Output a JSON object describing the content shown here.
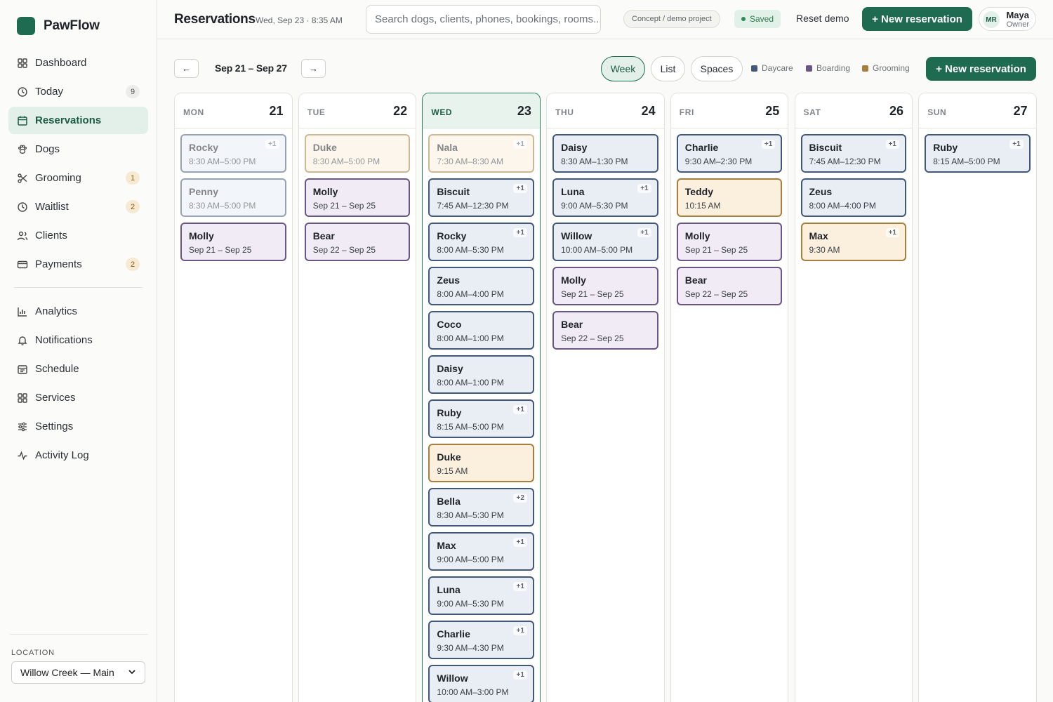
{
  "app": {
    "name": "PawFlow"
  },
  "sidebar": {
    "items": [
      {
        "label": "Dashboard",
        "icon": "dashboard-icon",
        "badge": ""
      },
      {
        "label": "Today",
        "icon": "clock-icon",
        "badge": "9"
      },
      {
        "label": "Reservations",
        "icon": "calendar-icon",
        "badge": ""
      },
      {
        "label": "Dogs",
        "icon": "paw-icon",
        "badge": ""
      },
      {
        "label": "Grooming",
        "icon": "scissors-icon",
        "badge": "1"
      },
      {
        "label": "Waitlist",
        "icon": "clock-icon",
        "badge": "2"
      },
      {
        "label": "Clients",
        "icon": "users-icon",
        "badge": ""
      },
      {
        "label": "Payments",
        "icon": "card-icon",
        "badge": "2"
      }
    ],
    "secondary": [
      {
        "label": "Analytics",
        "icon": "chart-icon"
      },
      {
        "label": "Notifications",
        "icon": "bell-icon"
      },
      {
        "label": "Schedule",
        "icon": "schedule-icon"
      },
      {
        "label": "Services",
        "icon": "grid-icon"
      },
      {
        "label": "Settings",
        "icon": "sliders-icon"
      },
      {
        "label": "Activity Log",
        "icon": "activity-icon"
      }
    ],
    "location_label": "LOCATION",
    "location_value": "Willow Creek — Main"
  },
  "header": {
    "title": "Reservations",
    "date": "Wed, Sep 23 · 8:35 AM",
    "search_placeholder": "Search dogs, clients, phones, bookings, rooms...",
    "demo_badge": "Concept / demo project",
    "saved": "Saved",
    "reset": "Reset demo",
    "new_reservation": "+ New reservation",
    "user": {
      "initials": "MR",
      "name": "Maya",
      "role": "Owner"
    }
  },
  "toolbar": {
    "prev": "←",
    "next": "→",
    "range": "Sep 21 – Sep 27",
    "views": [
      "Week",
      "List",
      "Spaces"
    ],
    "active_view": "Week",
    "legend": [
      {
        "label": "Daycare",
        "color": "#41587a"
      },
      {
        "label": "Boarding",
        "color": "#6a5683"
      },
      {
        "label": "Grooming",
        "color": "#a77e3c"
      }
    ],
    "new_reservation": "+ New reservation"
  },
  "week": [
    {
      "day": "MON",
      "date": "21",
      "events": [
        {
          "pet": "Rocky",
          "time": "8:30 AM–5:00 PM",
          "type": "daycare",
          "extra": "+1",
          "past": true
        },
        {
          "pet": "Penny",
          "time": "8:30 AM–5:00 PM",
          "type": "daycare",
          "extra": "",
          "past": true
        },
        {
          "pet": "Molly",
          "time": "Sep 21 – Sep 25",
          "type": "boarding",
          "extra": "",
          "past": false
        }
      ]
    },
    {
      "day": "TUE",
      "date": "22",
      "events": [
        {
          "pet": "Duke",
          "time": "8:30 AM–5:00 PM",
          "type": "grooming",
          "extra": "",
          "past": true
        },
        {
          "pet": "Molly",
          "time": "Sep 21 – Sep 25",
          "type": "boarding",
          "extra": "",
          "past": false
        },
        {
          "pet": "Bear",
          "time": "Sep 22 – Sep 25",
          "type": "boarding",
          "extra": "",
          "past": false
        }
      ]
    },
    {
      "day": "WED",
      "date": "23",
      "today": true,
      "events": [
        {
          "pet": "Nala",
          "time": "7:30 AM–8:30 AM",
          "type": "grooming",
          "extra": "+1",
          "past": true
        },
        {
          "pet": "Biscuit",
          "time": "7:45 AM–12:30 PM",
          "type": "daycare",
          "extra": "+1",
          "past": false
        },
        {
          "pet": "Rocky",
          "time": "8:00 AM–5:30 PM",
          "type": "daycare",
          "extra": "+1",
          "past": false
        },
        {
          "pet": "Zeus",
          "time": "8:00 AM–4:00 PM",
          "type": "daycare",
          "extra": "",
          "past": false
        },
        {
          "pet": "Coco",
          "time": "8:00 AM–1:00 PM",
          "type": "daycare",
          "extra": "",
          "past": false
        },
        {
          "pet": "Daisy",
          "time": "8:00 AM–1:00 PM",
          "type": "daycare",
          "extra": "",
          "past": false
        },
        {
          "pet": "Ruby",
          "time": "8:15 AM–5:00 PM",
          "type": "daycare",
          "extra": "+1",
          "past": false
        },
        {
          "pet": "Duke",
          "time": "9:15 AM",
          "type": "grooming",
          "extra": "",
          "past": false
        },
        {
          "pet": "Bella",
          "time": "8:30 AM–5:30 PM",
          "type": "daycare",
          "extra": "+2",
          "past": false
        },
        {
          "pet": "Max",
          "time": "9:00 AM–5:00 PM",
          "type": "daycare",
          "extra": "+1",
          "past": false
        },
        {
          "pet": "Luna",
          "time": "9:00 AM–5:30 PM",
          "type": "daycare",
          "extra": "+1",
          "past": false
        },
        {
          "pet": "Charlie",
          "time": "9:30 AM–4:30 PM",
          "type": "daycare",
          "extra": "+1",
          "past": false
        },
        {
          "pet": "Willow",
          "time": "10:00 AM–3:00 PM",
          "type": "daycare",
          "extra": "+1",
          "past": false
        }
      ]
    },
    {
      "day": "THU",
      "date": "24",
      "events": [
        {
          "pet": "Daisy",
          "time": "8:30 AM–1:30 PM",
          "type": "daycare",
          "extra": "",
          "past": false
        },
        {
          "pet": "Luna",
          "time": "9:00 AM–5:30 PM",
          "type": "daycare",
          "extra": "+1",
          "past": false
        },
        {
          "pet": "Willow",
          "time": "10:00 AM–5:00 PM",
          "type": "daycare",
          "extra": "+1",
          "past": false
        },
        {
          "pet": "Molly",
          "time": "Sep 21 – Sep 25",
          "type": "boarding",
          "extra": "",
          "past": false
        },
        {
          "pet": "Bear",
          "time": "Sep 22 – Sep 25",
          "type": "boarding",
          "extra": "",
          "past": false
        }
      ]
    },
    {
      "day": "FRI",
      "date": "25",
      "events": [
        {
          "pet": "Charlie",
          "time": "9:30 AM–2:30 PM",
          "type": "daycare",
          "extra": "+1",
          "past": false
        },
        {
          "pet": "Teddy",
          "time": "10:15 AM",
          "type": "grooming",
          "extra": "",
          "past": false
        },
        {
          "pet": "Molly",
          "time": "Sep 21 – Sep 25",
          "type": "boarding",
          "extra": "",
          "past": false
        },
        {
          "pet": "Bear",
          "time": "Sep 22 – Sep 25",
          "type": "boarding",
          "extra": "",
          "past": false
        }
      ]
    },
    {
      "day": "SAT",
      "date": "26",
      "events": [
        {
          "pet": "Biscuit",
          "time": "7:45 AM–12:30 PM",
          "type": "daycare",
          "extra": "+1",
          "past": false
        },
        {
          "pet": "Zeus",
          "time": "8:00 AM–4:00 PM",
          "type": "daycare",
          "extra": "",
          "past": false
        },
        {
          "pet": "Max",
          "time": "9:30 AM",
          "type": "grooming",
          "extra": "+1",
          "past": false
        }
      ]
    },
    {
      "day": "SUN",
      "date": "27",
      "events": [
        {
          "pet": "Ruby",
          "time": "8:15 AM–5:00 PM",
          "type": "daycare",
          "extra": "+1",
          "past": false
        }
      ]
    }
  ]
}
